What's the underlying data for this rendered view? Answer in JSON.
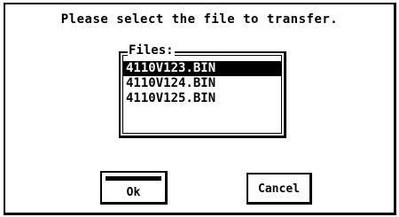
{
  "dialog": {
    "prompt": "Please select the file to transfer.",
    "files_label": "Files:",
    "files": [
      {
        "name": "4110V123.BIN",
        "selected": true
      },
      {
        "name": "4110V124.BIN",
        "selected": false
      },
      {
        "name": "4110V125.BIN",
        "selected": false
      }
    ],
    "ok_label": "Ok",
    "cancel_label": "Cancel"
  }
}
